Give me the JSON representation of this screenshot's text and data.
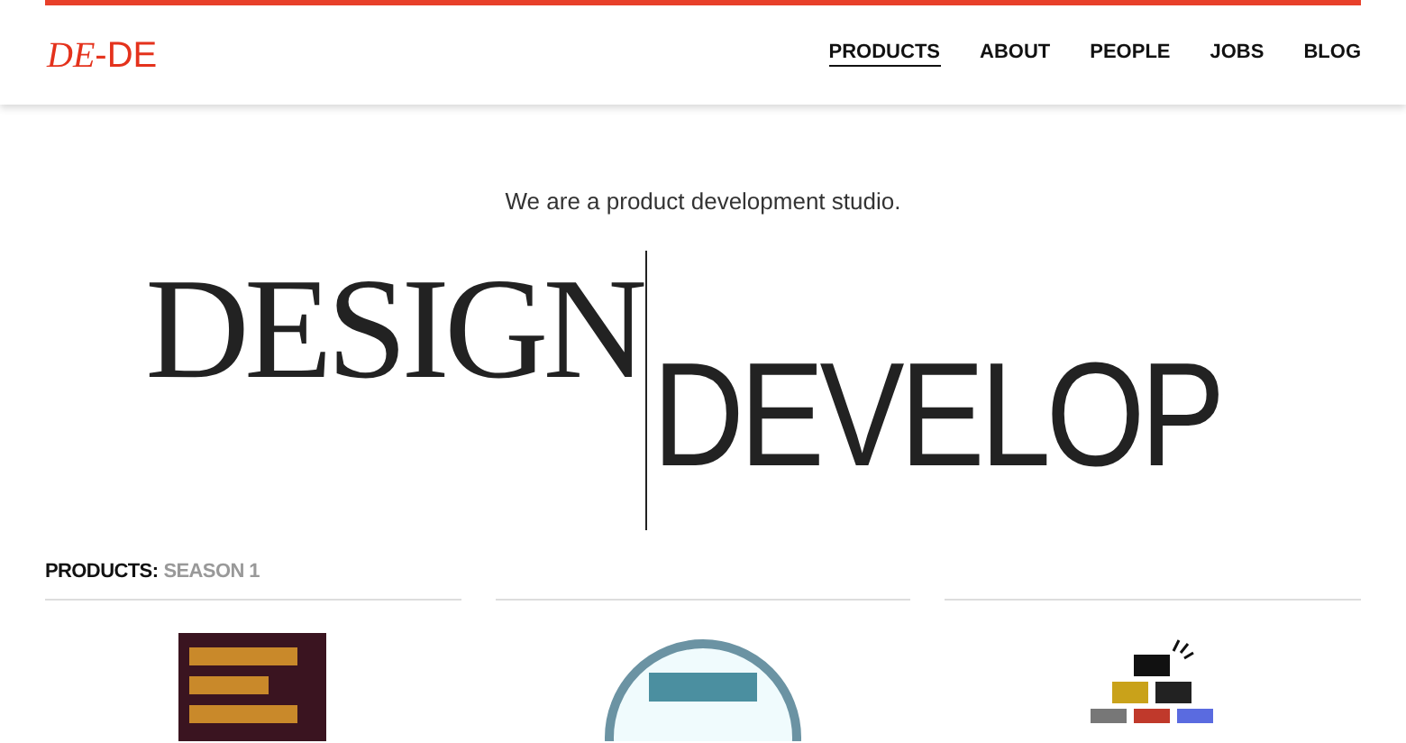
{
  "logo": {
    "serif_part": "DE",
    "sans_part": "-DE"
  },
  "nav": [
    {
      "label": "PRODUCTS",
      "selected": true
    },
    {
      "label": "ABOUT",
      "selected": false
    },
    {
      "label": "PEOPLE",
      "selected": false
    },
    {
      "label": "JOBS",
      "selected": false
    },
    {
      "label": "BLOG",
      "selected": false
    }
  ],
  "tagline": "We are a product development studio.",
  "headline": {
    "left_word": "DESIGN",
    "right_word": "DEVELOP"
  },
  "products_heading": {
    "label": "PRODUCTS:",
    "season": "SEASON 1"
  },
  "products": [
    {
      "kind": "poster"
    },
    {
      "kind": "badge"
    },
    {
      "kind": "cameras"
    }
  ]
}
